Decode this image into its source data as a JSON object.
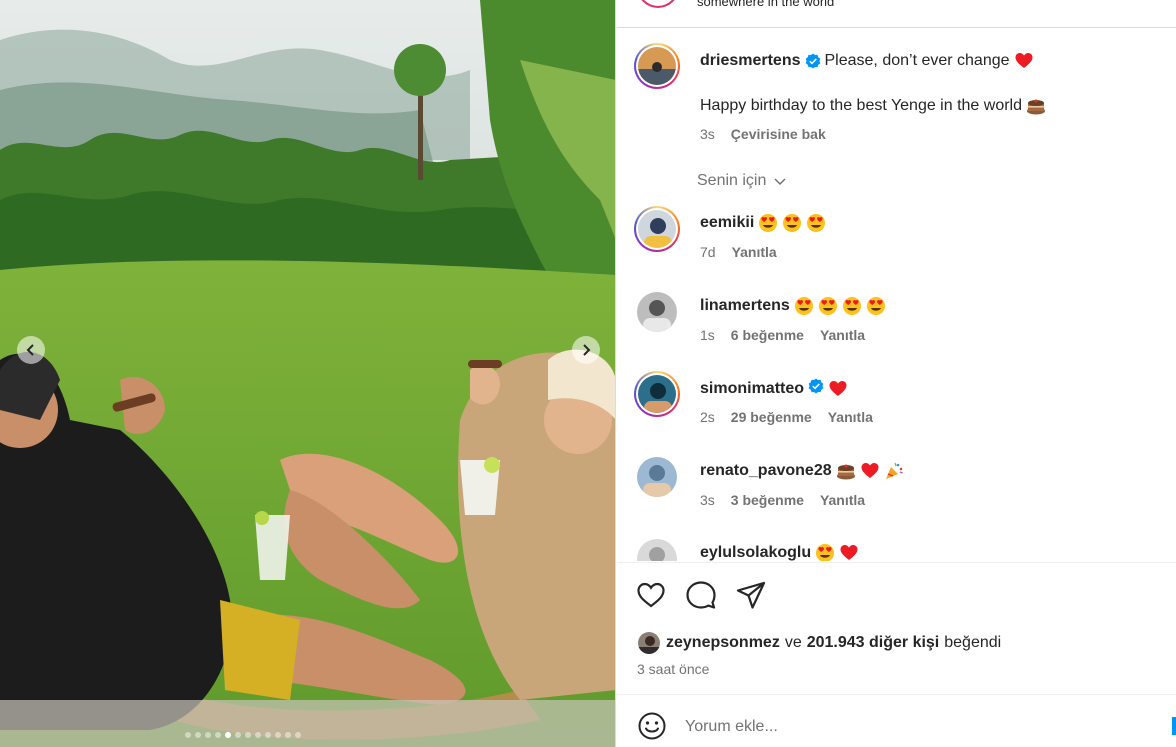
{
  "post": {
    "location_text": "somewhere in the world",
    "image_slide_count": 12,
    "image_active_index": 4
  },
  "caption": {
    "username": "driesmertens",
    "verified": true,
    "line1": "Please, don’t ever change",
    "line2": "Happy birthday to the best Yenge in the world",
    "time": "3s",
    "translate_label": "Çevirisine bak"
  },
  "for_you_label": "Senin için",
  "comments": [
    {
      "username": "eemikii",
      "emoji": [
        "heart-eyes",
        "heart-eyes",
        "heart-eyes"
      ],
      "time": "7d",
      "likes": "",
      "reply_label": "Yanıtla"
    },
    {
      "username": "linamertens",
      "emoji": [
        "heart-eyes",
        "heart-eyes",
        "heart-eyes",
        "heart-eyes"
      ],
      "time": "1s",
      "likes": "6 beğenme",
      "reply_label": "Yanıtla"
    },
    {
      "username": "simonimatteo",
      "verified": true,
      "emoji": [
        "red-heart"
      ],
      "time": "2s",
      "likes": "29 beğenme",
      "reply_label": "Yanıtla"
    },
    {
      "username": "renato_pavone28",
      "emoji": [
        "cake",
        "red-heart",
        "party-popper"
      ],
      "time": "3s",
      "likes": "3 beğenme",
      "reply_label": "Yanıtla"
    },
    {
      "username": "eylulsolakoglu",
      "emoji": [
        "heart-eyes",
        "red-heart"
      ],
      "time": "",
      "likes": "",
      "reply_label": ""
    }
  ],
  "likes": {
    "liker": "zeynepsonmez",
    "connector": "ve",
    "others": "201.943 diğer kişi",
    "suffix": "beğendi"
  },
  "posted_time": "3 saat önce",
  "comment_box": {
    "placeholder": "Yorum ekle..."
  },
  "colors": {
    "verified_blue": "#0095f6",
    "heart_red": "#ed1c24",
    "meta_gray": "#737373",
    "text": "#262626"
  }
}
